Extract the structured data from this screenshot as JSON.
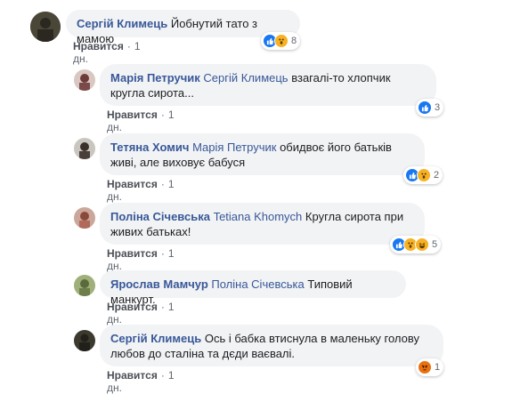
{
  "comments": [
    {
      "author": "Сергій Климець",
      "mention": "",
      "text": "Йобнутий тато з мамою",
      "like": "Нравится",
      "time": "1 дн.",
      "react_count": "8"
    },
    {
      "author": "Марія Петручик",
      "mention": "Сергій Климець",
      "text": "взагалі-то хлопчик кругла сирота...",
      "like": "Нравится",
      "time": "1 дн.",
      "react_count": "3"
    },
    {
      "author": "Тетяна Хомич",
      "mention": "Марія Петручик",
      "text": "обидвоє його батьків живі, але виховує бабуся",
      "like": "Нравится",
      "time": "1 дн.",
      "react_count": "2"
    },
    {
      "author": "Поліна Січевська",
      "mention": "Tetiana Khomych",
      "text": "Кругла сирота при живих батьках!",
      "like": "Нравится",
      "time": "1 дн.",
      "react_count": "5"
    },
    {
      "author": "Ярослав Мамчур",
      "mention": "Поліна Січевська",
      "text": "Типовий манкурт.",
      "like": "Нравится",
      "time": "1 дн.",
      "react_count": ""
    },
    {
      "author": "Сергій Климець",
      "mention": "",
      "text": "Ось і бабка втиснула в маленьку голову любов до сталіна та дєди ваєвалі.",
      "like": "Нравится",
      "time": "1 дн.",
      "react_count": "1"
    }
  ],
  "colors": {
    "link": "#385898",
    "bubble": "#f2f3f5",
    "like_blue": "#1877f2",
    "wow_yellow": "#f7b125",
    "angry": "#e9710f"
  }
}
